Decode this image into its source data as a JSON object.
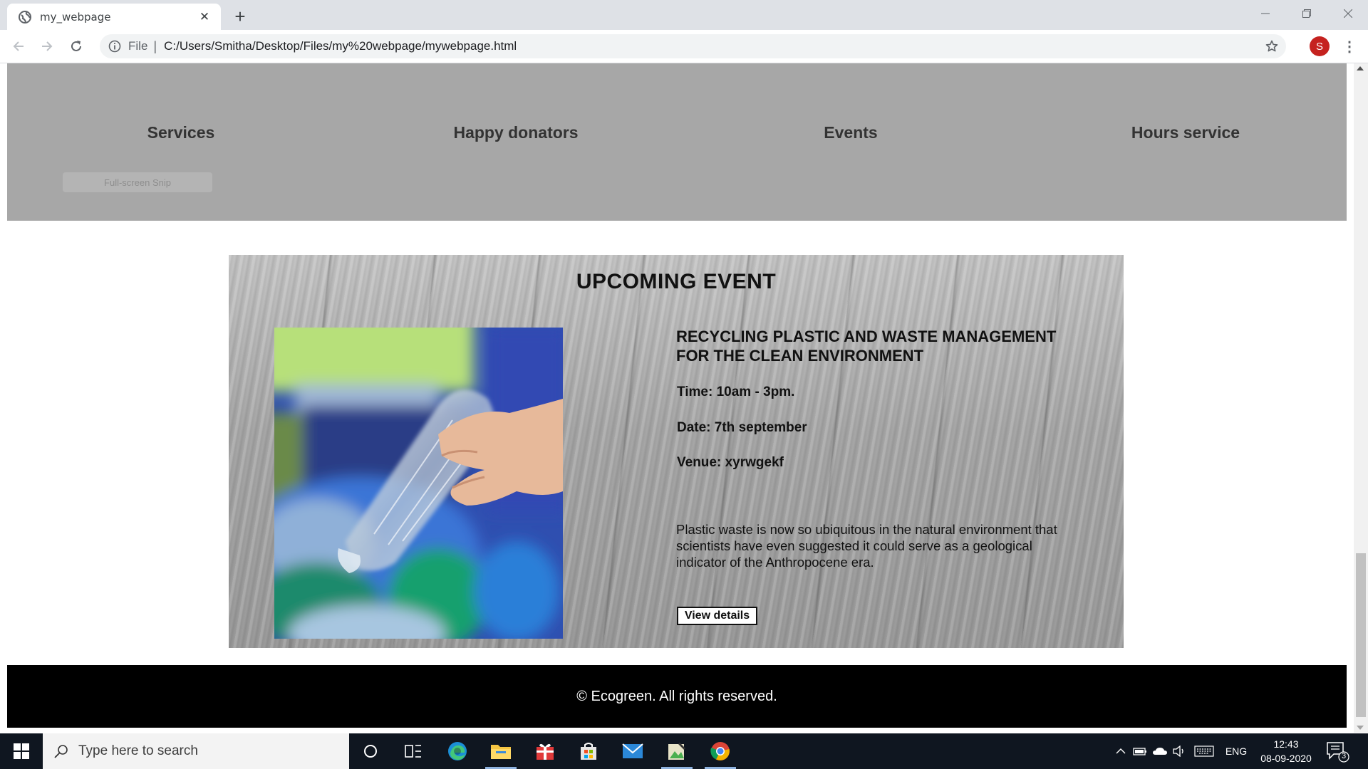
{
  "browser": {
    "tab_title": "my_webpage",
    "file_label": "File",
    "url": "C:/Users/Smitha/Desktop/Files/my%20webpage/mywebpage.html",
    "profile_initial": "S"
  },
  "stats": {
    "labels": [
      "Services",
      "Happy donators",
      "Events",
      "Hours service"
    ],
    "snip_hint": "Full-screen Snip"
  },
  "event": {
    "heading": "UPCOMING EVENT",
    "title_line1": "RECYCLING PLASTIC AND WASTE MANAGEMENT",
    "title_line2": "FOR THE CLEAN ENVIRONMENT",
    "time": "Time: 10am - 3pm.",
    "date": "Date: 7th september",
    "venue": "Venue: xyrwgekf",
    "description": "Plastic waste is now so ubiquitous in the natural environment that scientists have even suggested it could serve as a geological indicator of the Anthropocene era.",
    "button_label": "View details"
  },
  "footer": {
    "text": "© Ecogreen. All rights reserved."
  },
  "taskbar": {
    "search_placeholder": "Type here to search",
    "language": "ENG",
    "time": "12:43",
    "date": "08-09-2020",
    "notification_count": "3"
  },
  "colors": {
    "stats_band": "#a7a7a7",
    "footer_bg": "#000000",
    "taskbar_bg": "#0f1620",
    "profile_avatar": "#c5221f"
  }
}
